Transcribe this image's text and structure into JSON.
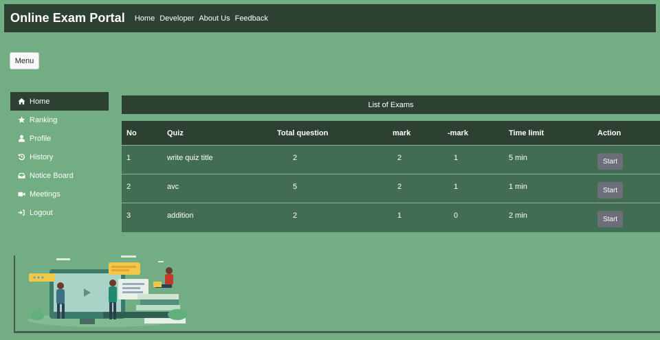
{
  "brand": "Online Exam Portal",
  "nav": [
    "Home",
    "Developer",
    "About Us",
    "Feedback"
  ],
  "menu_button": "Menu",
  "sidebar": {
    "items": [
      {
        "label": "Home",
        "icon": "home-icon",
        "active": true
      },
      {
        "label": "Ranking",
        "icon": "star-icon",
        "active": false
      },
      {
        "label": "Profile",
        "icon": "user-icon",
        "active": false
      },
      {
        "label": "History",
        "icon": "history-icon",
        "active": false
      },
      {
        "label": "Notice Board",
        "icon": "inbox-icon",
        "active": false
      },
      {
        "label": "Meetings",
        "icon": "video-icon",
        "active": false
      },
      {
        "label": "Logout",
        "icon": "logout-icon",
        "active": false
      }
    ]
  },
  "exams": {
    "title": "List of Exams",
    "columns": [
      "No",
      "Quiz",
      "Total question",
      "mark",
      "-mark",
      "Time limit",
      "Action"
    ],
    "rows": [
      {
        "no": "1",
        "quiz": "write quiz title",
        "total": "2",
        "mark": "2",
        "neg": "1",
        "time": "5 min",
        "action": "Start"
      },
      {
        "no": "2",
        "quiz": "avc",
        "total": "5",
        "mark": "2",
        "neg": "1",
        "time": "1 min",
        "action": "Start"
      },
      {
        "no": "3",
        "quiz": "addition",
        "total": "2",
        "mark": "1",
        "neg": "0",
        "time": "2 min",
        "action": "Start"
      }
    ]
  },
  "colors": {
    "background": "#72ad83",
    "navbar": "#2d4132",
    "table_body": "#426d52",
    "start_button": "#6b6f79"
  }
}
